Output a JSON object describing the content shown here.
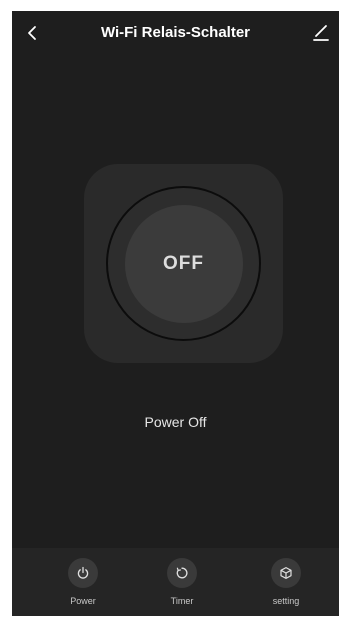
{
  "header": {
    "title": "Wi-Fi Relais-Schalter",
    "back_icon": "chevron-left-icon",
    "edit_icon": "pencil-icon"
  },
  "switch": {
    "state_label": "OFF"
  },
  "status": {
    "text": "Power Off"
  },
  "bottom_bar": {
    "items": [
      {
        "label": "Power",
        "icon": "power-icon"
      },
      {
        "label": "Timer",
        "icon": "timer-icon"
      },
      {
        "label": "setting",
        "icon": "settings-cube-icon"
      }
    ]
  },
  "colors": {
    "background": "#1e1e1e",
    "panel": "#2a2a2a",
    "button": "#3b3b3b",
    "bottom_bar": "#252525",
    "text": "#ffffff"
  }
}
